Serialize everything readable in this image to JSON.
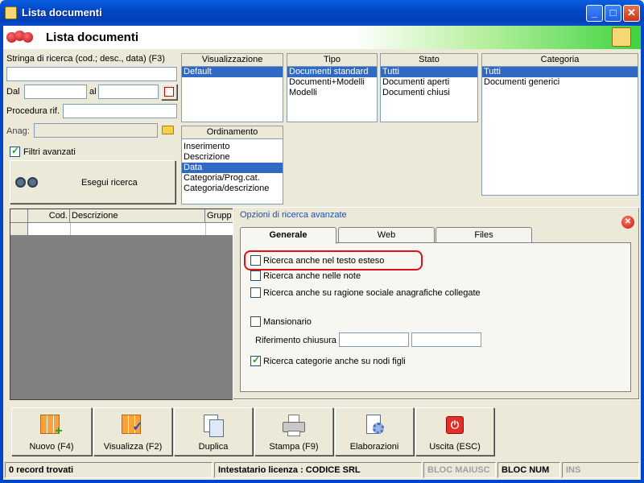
{
  "window": {
    "title": "Lista documenti",
    "minimize_glyph": "_",
    "maximize_glyph": "□",
    "close_glyph": "✕"
  },
  "header": {
    "title": "Lista documenti"
  },
  "search": {
    "label": "Stringa di ricerca (cod.; desc., data) (F3)",
    "value": "",
    "dal_label": "Dal",
    "dal_value": "",
    "al_label": "al",
    "al_value": "",
    "procedura_label": "Procedura rif.",
    "procedura_value": "",
    "anag_label": "Anag:",
    "anag_value": "",
    "filtri_label": "Filtri avanzati",
    "filtri_checked": true,
    "execute_label": "Esegui ricerca"
  },
  "visualizzazione": {
    "header": "Visualizzazione",
    "items": [
      "Default"
    ],
    "selected": 0
  },
  "ordinamento": {
    "header": "Ordinamento",
    "items": [
      "Inserimento",
      "Descrizione",
      "Data",
      "Categoria/Prog.cat.",
      "Categoria/descrizione"
    ],
    "selected": 2
  },
  "tipo": {
    "header": "Tipo",
    "items": [
      "Documenti standard",
      "Documenti+Modelli",
      "Modelli"
    ],
    "selected": 0
  },
  "stato": {
    "header": "Stato",
    "items": [
      "Tutti",
      "Documenti aperti",
      "Documenti chiusi"
    ],
    "selected": 0
  },
  "categoria": {
    "header": "Categoria",
    "items": [
      "Tutti",
      "Documenti generici"
    ],
    "selected": 0
  },
  "grid": {
    "columns": [
      "",
      "Cod.",
      "Descrizione",
      "Grupp"
    ]
  },
  "advanced": {
    "title": "Opzioni di ricerca avanzate",
    "tabs": [
      "Generale",
      "Web",
      "Files"
    ],
    "active_tab": 0,
    "options": [
      {
        "label": "Ricerca anche nel testo esteso",
        "checked": false
      },
      {
        "label": "Ricerca anche nelle note",
        "checked": false
      },
      {
        "label": "Ricerca anche su ragione sociale anagrafiche collegate",
        "checked": false
      },
      {
        "label": "Mansionario",
        "checked": false
      }
    ],
    "riferimento_label": "Riferimento chiusura :",
    "riferimento_value1": "",
    "riferimento_value2": "",
    "nodi_label": "Ricerca categorie anche su nodi figli",
    "nodi_checked": true,
    "highlight_color": "#e0101a"
  },
  "toolbar": {
    "buttons": [
      {
        "label": "Nuovo (F4)",
        "icon": "new-grid-icon"
      },
      {
        "label": "Visualizza (F2)",
        "icon": "view-grid-icon"
      },
      {
        "label": "Duplica",
        "icon": "duplicate-icon"
      },
      {
        "label": "Stampa (F9)",
        "icon": "printer-icon"
      },
      {
        "label": "Elaborazioni",
        "icon": "gears-icon"
      },
      {
        "label": "Uscita (ESC)",
        "icon": "exit-icon"
      }
    ]
  },
  "statusbar": {
    "records": "0 record trovati",
    "licenza": "Intestatario licenza : CODICE SRL",
    "bloc_maiusc": "BLOC MAIUSC",
    "bloc_num": "BLOC NUM",
    "ins": "INS"
  }
}
